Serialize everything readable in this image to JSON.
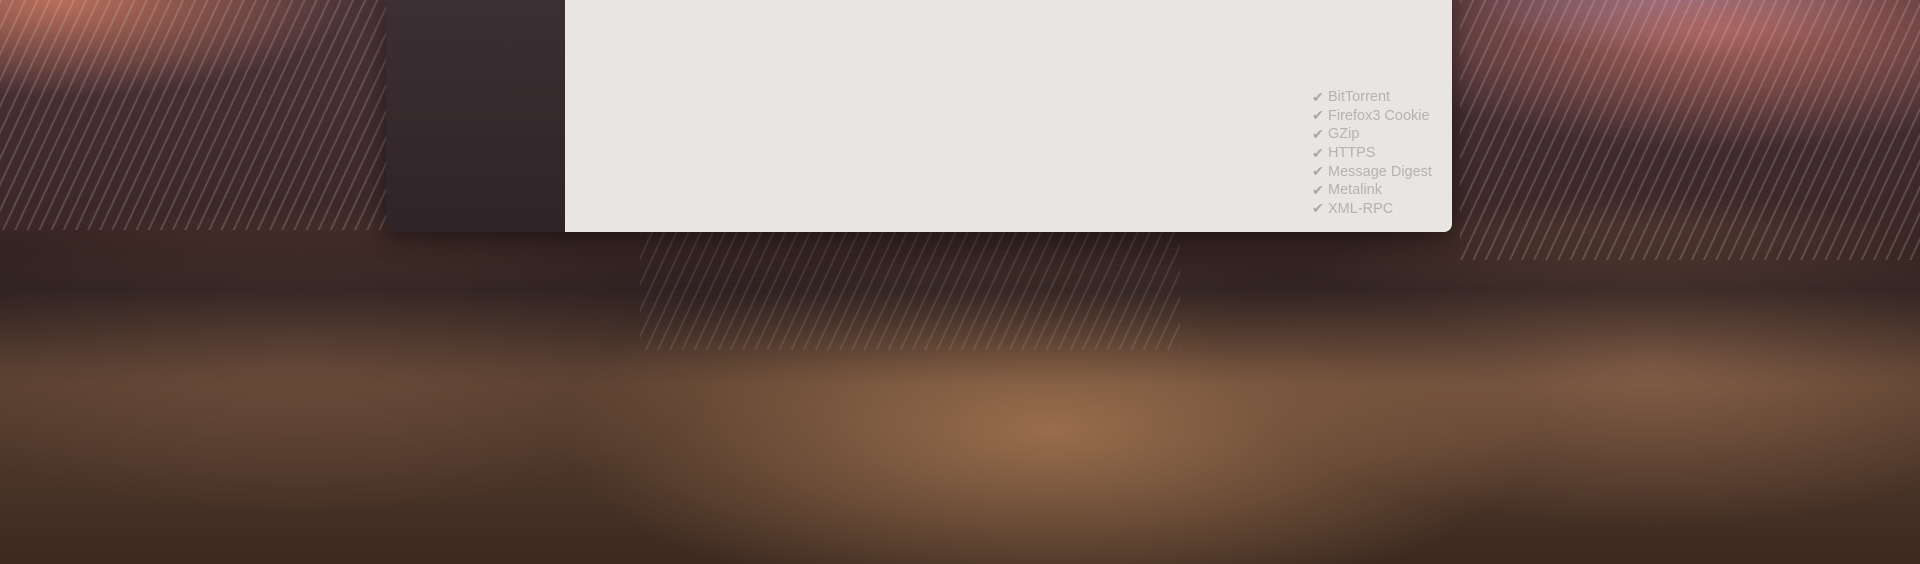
{
  "features": {
    "check_glyph": "✔",
    "items": [
      "BitTorrent",
      "Firefox3 Cookie",
      "GZip",
      "HTTPS",
      "Message Digest",
      "Metalink",
      "XML-RPC"
    ]
  },
  "colors": {
    "sidebar": "#3d3034",
    "content_background": "#e8e5e2",
    "feature_text": "#b5b2af"
  }
}
